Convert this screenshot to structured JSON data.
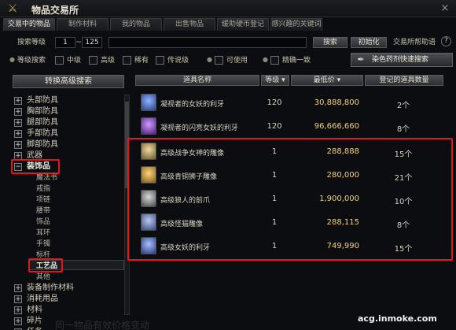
{
  "window": {
    "title": "物品交易所",
    "close": "×"
  },
  "tabs": [
    "交易中的物品",
    "制作材料",
    "我的物品",
    "出售物品",
    "缓助硬币登记",
    "感兴趣的关键词"
  ],
  "filters": {
    "search_level_label": "搜索等级",
    "level_min": "1",
    "level_sep": "~",
    "level_max": "125",
    "search_value": "",
    "search_button": "搜索",
    "reset_button": "初始化",
    "help_label": "交易所帮助语",
    "grade_label": "等级搜索",
    "grade_options": [
      "中级",
      "高级",
      "稀有",
      "传说级",
      "可使用",
      "精确一致"
    ],
    "dye_button": "染色药剂快速搜索"
  },
  "left_panel": {
    "advanced_button": "转换高级搜索",
    "categories": [
      {
        "label": "头部防具",
        "exp": "+"
      },
      {
        "label": "胸部防具",
        "exp": "+"
      },
      {
        "label": "腿部防具",
        "exp": "+"
      },
      {
        "label": "手部防具",
        "exp": "+"
      },
      {
        "label": "脚部防具",
        "exp": "+"
      },
      {
        "label": "武器",
        "exp": "+"
      },
      {
        "label": "装饰品",
        "exp": "−"
      }
    ],
    "subcategories": [
      "魔法书",
      "戒指",
      "项链",
      "腰带",
      "饰品",
      "耳环",
      "手镯",
      "标杆",
      "工艺品",
      "其他"
    ],
    "categories_after": [
      {
        "label": "装备制作材料",
        "exp": "+"
      },
      {
        "label": "消耗用品",
        "exp": "+"
      },
      {
        "label": "材料",
        "exp": "+"
      },
      {
        "label": "碎片",
        "exp": "+"
      },
      {
        "label": "任务",
        "exp": "+"
      }
    ]
  },
  "table": {
    "headers": {
      "name": "道具名称",
      "level": "等级",
      "price": "最低价",
      "qty": "登记的道具数量"
    },
    "rows": [
      {
        "name": "凝视者的女妖的利牙",
        "level": "120",
        "price": "30,888,800",
        "qty": "2个",
        "icon_color": "#3b6fd0"
      },
      {
        "name": "凝视者的闪亮女妖的利牙",
        "level": "120",
        "price": "96,666,660",
        "qty": "8个",
        "icon_color": "#9b4fd0"
      },
      {
        "name": "高级战争女神的雕像",
        "level": "1",
        "price": "288,888",
        "qty": "15个",
        "icon_color": "#b89a5a"
      },
      {
        "name": "高级青铜狮子雕像",
        "level": "1",
        "price": "280,000",
        "qty": "21个",
        "icon_color": "#c49a3a"
      },
      {
        "name": "高级狼人的前爪",
        "level": "1",
        "price": "1,900,000",
        "qty": "10个",
        "icon_color": "#8a8a8a"
      },
      {
        "name": "高级怪猫雕像",
        "level": "1",
        "price": "288,115",
        "qty": "8个",
        "icon_color": "#6a7fb0"
      },
      {
        "name": "高级女妖的利牙",
        "level": "1",
        "price": "749,990",
        "qty": "15个",
        "icon_color": "#5a7ad0"
      }
    ]
  },
  "watermark": "acg.inmoke.com",
  "ghost_text": "同一物品有效价格变动"
}
